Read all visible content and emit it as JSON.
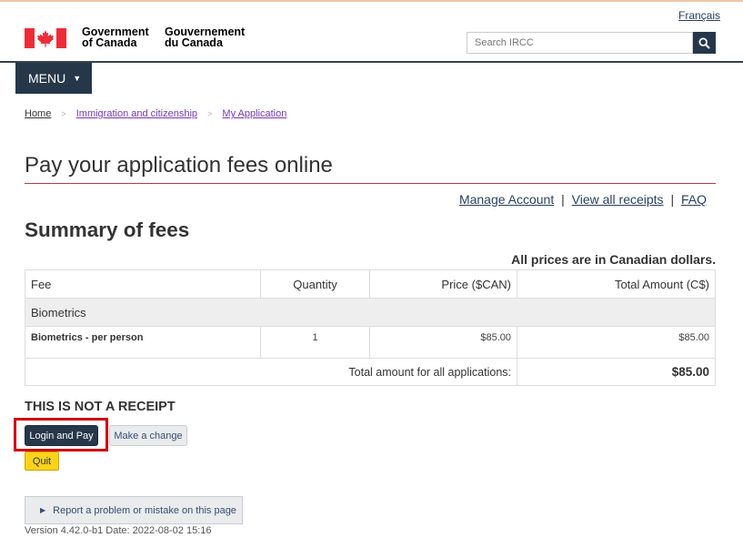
{
  "header": {
    "language_link": "Français",
    "gov_en_line1": "Government",
    "gov_en_line2": "of Canada",
    "gov_fr_line1": "Gouvernement",
    "gov_fr_line2": "du Canada",
    "search_placeholder": "Search IRCC",
    "search_icon": "search-icon",
    "menu_label": "MENU"
  },
  "breadcrumb": [
    "Home",
    "Immigration and citizenship",
    "My Application"
  ],
  "page": {
    "title": "Pay your application fees online",
    "links": {
      "manage_account": "Manage Account",
      "view_receipts": "View all receipts",
      "faq": "FAQ",
      "separator": "|"
    },
    "summary_title": "Summary of fees",
    "prices_note": "All prices are in Canadian dollars."
  },
  "fees_table": {
    "headers": [
      "Fee",
      "Quantity",
      "Price ($CAN)",
      "Total Amount (C$)"
    ],
    "group": "Biometrics",
    "rows": [
      {
        "fee": "Biometrics - per person",
        "quantity": "1",
        "price": "$85.00",
        "total": "$85.00"
      }
    ],
    "total_label": "Total amount for all applications:",
    "total_amount": "$85.00"
  },
  "actions": {
    "not_receipt": "THIS IS NOT A RECEIPT",
    "login_pay": "Login and Pay",
    "make_change": "Make a change",
    "quit": "Quit",
    "report_problem": "Report a problem or mistake on this page"
  },
  "footer": {
    "version": "Version 4.42.0-b1 Date: 2022-08-02 15:16"
  },
  "colors": {
    "navy": "#26374a",
    "link": "#284162",
    "title_rule": "#af3c43",
    "quit_yellow": "#f9d31b",
    "highlight_red": "#d3080c"
  }
}
